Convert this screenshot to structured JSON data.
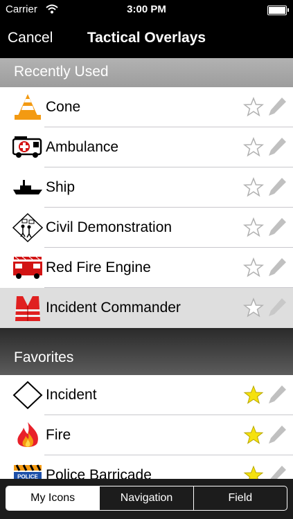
{
  "status_bar": {
    "carrier": "Carrier",
    "time": "3:00 PM"
  },
  "nav": {
    "cancel_label": "Cancel",
    "title": "Tactical Overlays"
  },
  "sections": {
    "recent": "Recently Used",
    "favorites": "Favorites"
  },
  "recent_items": [
    {
      "label": "Cone",
      "icon": "traffic-cone-icon",
      "favorite": false
    },
    {
      "label": "Ambulance",
      "icon": "ambulance-icon",
      "favorite": false
    },
    {
      "label": "Ship",
      "icon": "ship-icon",
      "favorite": false
    },
    {
      "label": "Civil Demonstration",
      "icon": "civil-demonstration-icon",
      "favorite": false
    },
    {
      "label": "Red Fire Engine",
      "icon": "fire-engine-icon",
      "favorite": false
    },
    {
      "label": "Incident Commander",
      "icon": "safety-vest-icon",
      "favorite": false,
      "selected": true
    }
  ],
  "favorite_items": [
    {
      "label": "Incident",
      "icon": "diamond-icon",
      "favorite": true
    },
    {
      "label": "Fire",
      "icon": "fire-icon",
      "favorite": true
    },
    {
      "label": "Police Barricade",
      "icon": "police-barricade-icon",
      "favorite": true,
      "sign_text": "POLICE"
    }
  ],
  "tabs": [
    {
      "label": "My Icons",
      "active": true
    },
    {
      "label": "Navigation",
      "active": false
    },
    {
      "label": "Field",
      "active": false
    }
  ],
  "colors": {
    "star_favorite": "#f5e10f",
    "star_outline": "#b0b0b0",
    "pencil": "#c0c0c0"
  }
}
